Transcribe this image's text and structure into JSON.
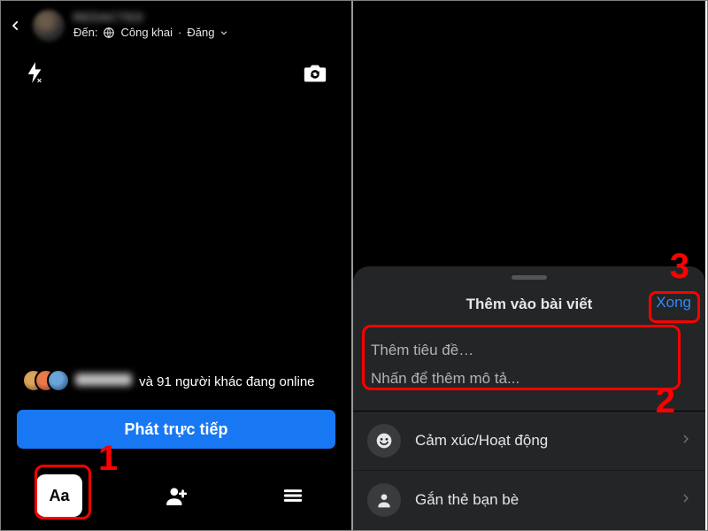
{
  "left": {
    "header": {
      "name": "REDACTED",
      "to_prefix": "Đến:",
      "privacy": "Công khai",
      "dot": "·",
      "post_label": "Đăng"
    },
    "camera": {
      "flash": "flash-off",
      "switch": "switch-camera"
    },
    "online_row": {
      "hidden_name": "REDACTED",
      "suffix": "và 91 người khác đang online"
    },
    "go_live_label": "Phát trực tiếp",
    "tabs": {
      "aa": "Aa"
    }
  },
  "right": {
    "sheet": {
      "title": "Thêm vào bài viết",
      "done": "Xong",
      "fields": {
        "title_placeholder": "Thêm tiêu đề…",
        "desc_placeholder": "Nhấn để thêm mô tả..."
      },
      "options": [
        {
          "icon": "smile",
          "label": "Cảm xúc/Hoạt động"
        },
        {
          "icon": "tag",
          "label": "Gắn thẻ bạn bè"
        }
      ]
    }
  },
  "annotations": {
    "n1": "1",
    "n2": "2",
    "n3": "3"
  }
}
